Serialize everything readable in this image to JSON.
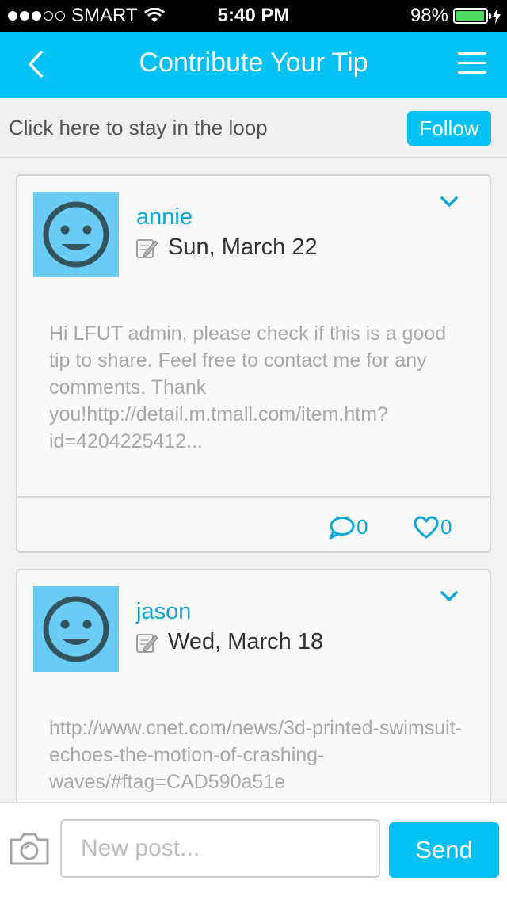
{
  "status_bar": {
    "carrier": "SMART",
    "time": "5:40 PM",
    "battery_percent": "98%",
    "battery_level": 0.98
  },
  "nav": {
    "title": "Contribute Your Tip",
    "back_icon": "chevron-left-icon",
    "menu_icon": "hamburger-menu-icon"
  },
  "follow_bar": {
    "text": "Click here to stay in the loop",
    "button_label": "Follow"
  },
  "posts": [
    {
      "username": "annie",
      "date": "Sun, March 22",
      "text": "Hi LFUT admin, please check if this is a good tip to share. Feel free to contact me for any comments. Thank you!http://detail.m.tmall.com/item.htm?id=4204225412...",
      "comments": "0",
      "likes": "0"
    },
    {
      "username": "jason",
      "date": "Wed, March 18",
      "text": "http://www.cnet.com/news/3d-printed-swimsuit-echoes-the-motion-of-crashing-waves/#ftag=CAD590a51e"
    }
  ],
  "composer": {
    "placeholder": "New post...",
    "value": "",
    "send_label": "Send"
  },
  "colors": {
    "accent": "#03c1f5",
    "link": "#0aa6dc",
    "avatar_bg": "#6acbf5",
    "battery": "#4cd964"
  }
}
